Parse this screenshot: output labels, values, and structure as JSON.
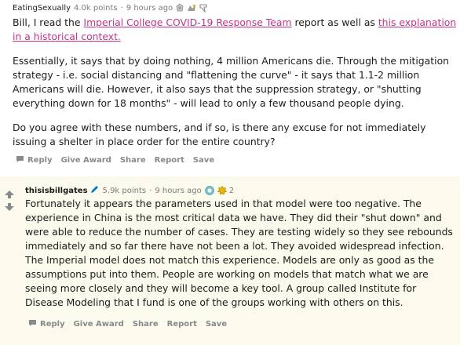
{
  "comment1": {
    "author": "EatingSexually",
    "points": "4.0k points",
    "separator": "·",
    "time": "9 hours ago",
    "paragraph1_prefix": "Bill, I read the ",
    "link1": "Imperial College COVID-19 Response Team",
    "paragraph1_mid": " report as well as ",
    "link2": "this explanation in a historical context.",
    "paragraph2": "Essentially, it says that by doing nothing, 4 million Americans die. Through the mitigation strategy - i.e. social distancing and \"flattening the curve\" - it says that 1.1-2 million Americans will die. However, it also says that the suppression strategy, or \"shutting everything down for 18 months\" - will lead to only a few thousand people dying.",
    "paragraph3": "Do you agree with these numbers, and if so, is there any excuse for not immediately issuing a shelter in place order for the entire country?",
    "actions": {
      "reply": "Reply",
      "give_award": "Give Award",
      "share": "Share",
      "report": "Report",
      "save": "Save"
    }
  },
  "comment2": {
    "author": "thisisbillgates",
    "points": "5.9k points",
    "separator": "·",
    "time": "9 hours ago",
    "award_count": "2",
    "body": "Fortunately it appears the parameters used in that model were too negative. The experience in China is the most critical data we have. They did their \"shut down\" and were able to reduce the number of cases. They are testing widely so they see rebounds immediately and so far there have not been a lot. They avoided widespread infection. The Imperial model does not match this experience. Models are only as good as the assumptions put into them. People are working on models that match what we are seeing more closely and they will become a key tool. A group called Institute for Disease Modeling that I fund is one of the groups working with others on this.",
    "actions": {
      "reply": "Reply",
      "give_award": "Give Award",
      "share": "Share",
      "report": "Report",
      "save": "Save"
    }
  },
  "icons": [
    "award-icon",
    "upvote-icon",
    "downvote-icon",
    "reply-icon",
    "pencil-icon"
  ],
  "colors": {
    "link": "#c2348a",
    "highlight_bg": "#fcfaec",
    "action_text": "#878a8c",
    "upvote": "#878a8c",
    "pencil": "#0079d3"
  }
}
